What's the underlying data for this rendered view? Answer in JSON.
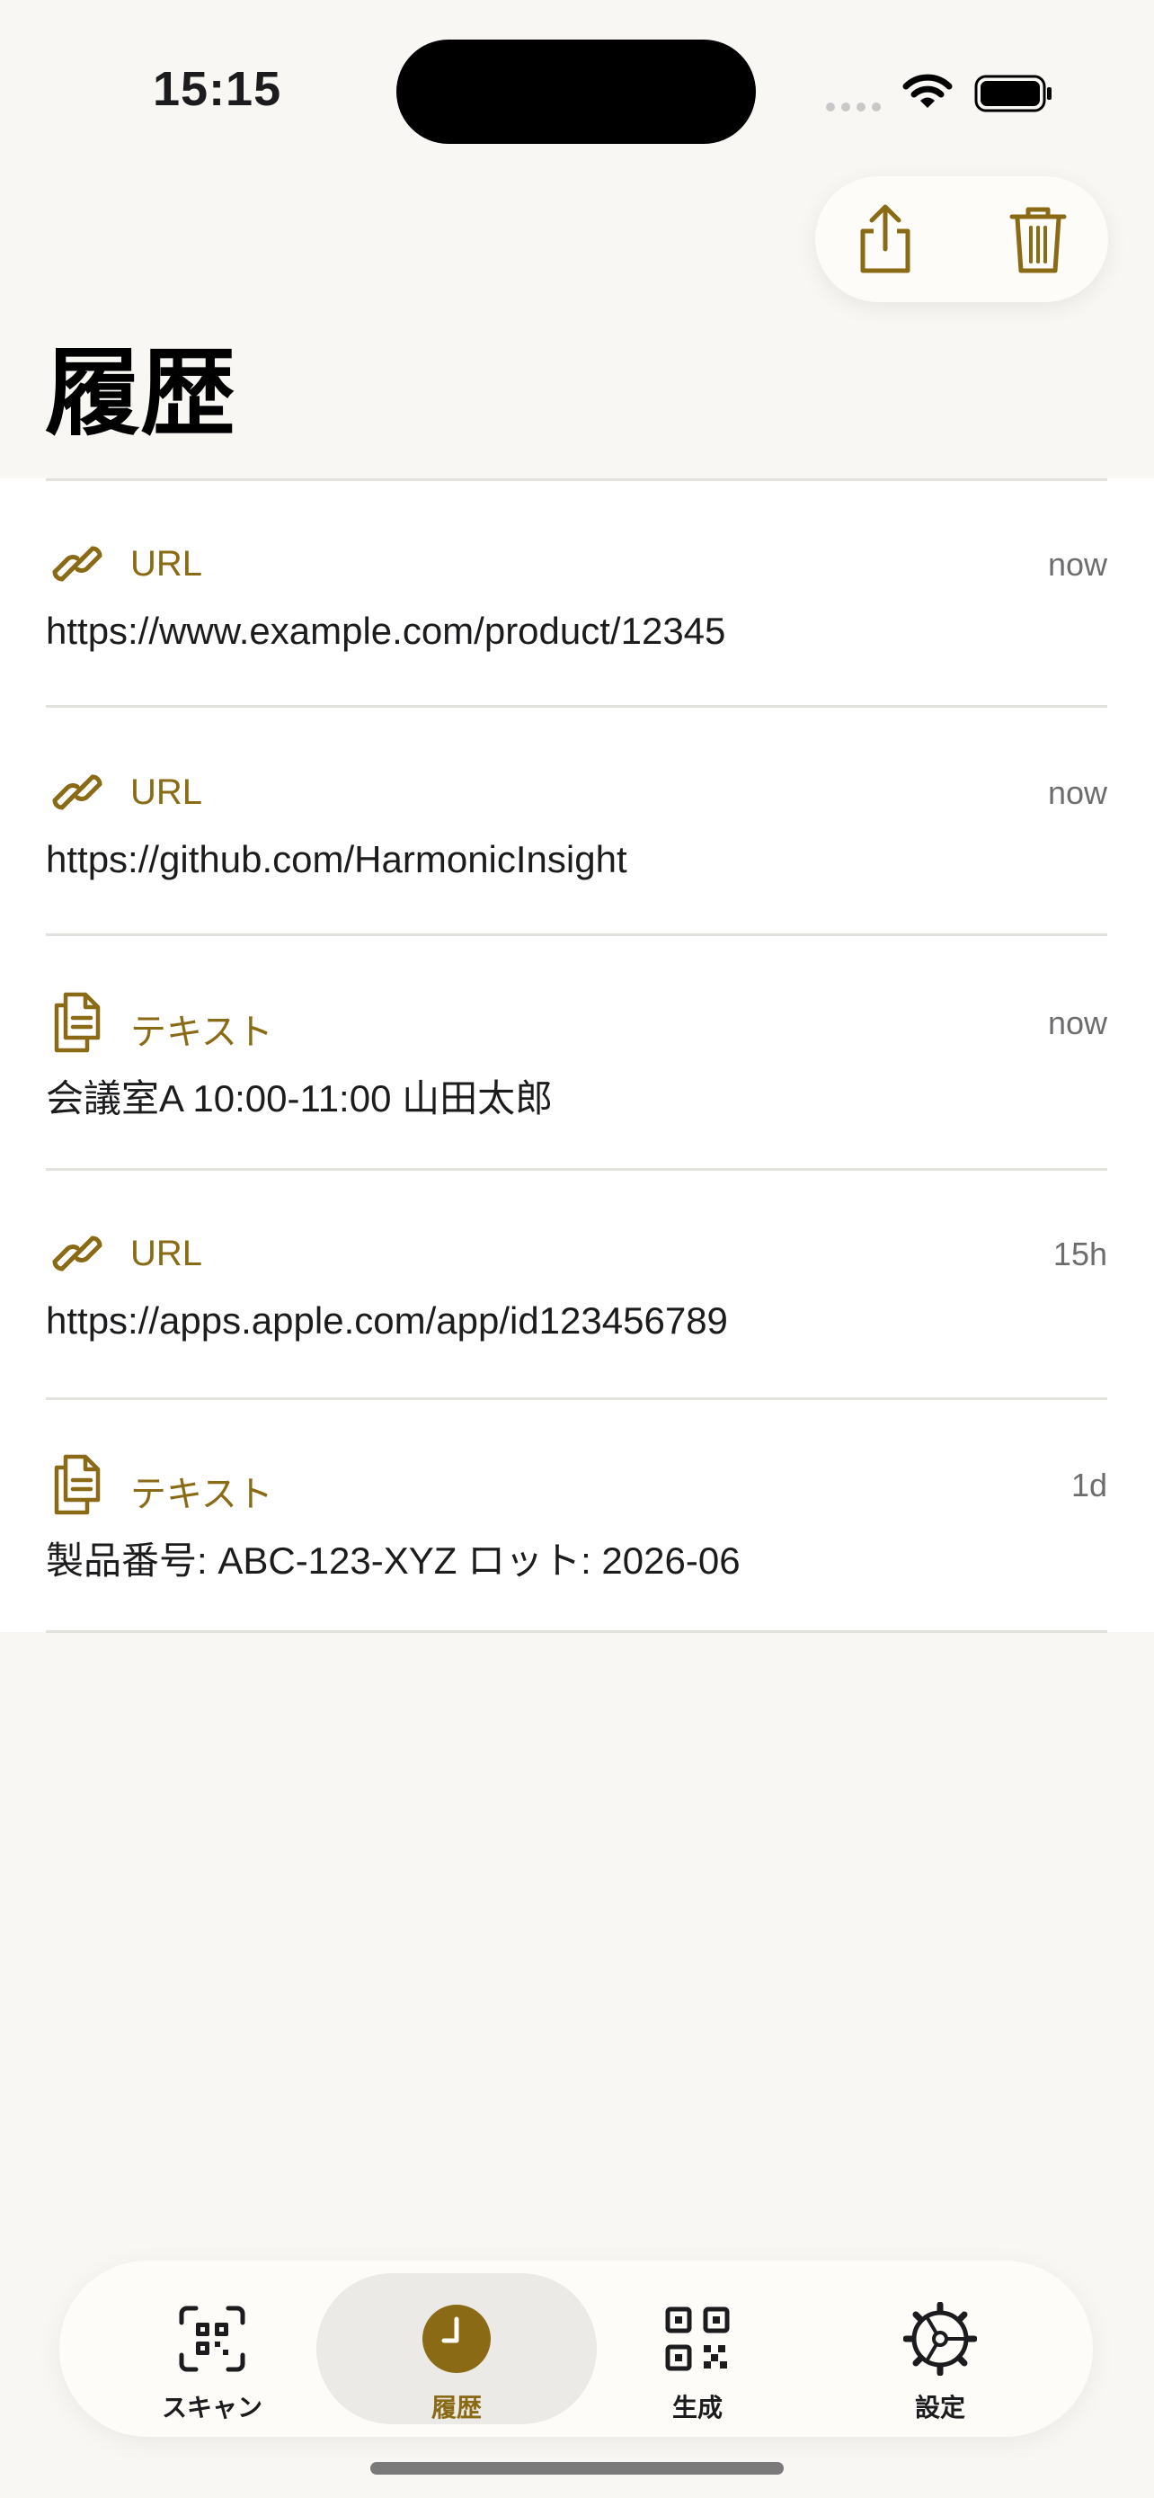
{
  "status": {
    "time": "15:15"
  },
  "toolbar": {
    "share_icon": "share-icon",
    "trash_icon": "trash-icon"
  },
  "page": {
    "title": "履歴"
  },
  "colors": {
    "accent": "#8a6a14",
    "background": "#f8f7f4"
  },
  "history": [
    {
      "icon": "link-icon",
      "type": "URL",
      "age": "now",
      "content": "https://www.example.com/product/12345"
    },
    {
      "icon": "link-icon",
      "type": "URL",
      "age": "now",
      "content": "https://github.com/HarmonicInsight"
    },
    {
      "icon": "document-icon",
      "type": "テキスト",
      "age": "now",
      "content": "会議室A 10:00-11:00 山田太郎"
    },
    {
      "icon": "link-icon",
      "type": "URL",
      "age": "15h",
      "content": "https://apps.apple.com/app/id123456789"
    },
    {
      "icon": "document-icon",
      "type": "テキスト",
      "age": "1d",
      "content": "製品番号: ABC-123-XYZ ロット: 2026-06"
    }
  ],
  "tabs": [
    {
      "label": "スキャン",
      "icon": "qr-scan-icon",
      "active": false
    },
    {
      "label": "履歴",
      "icon": "clock-icon",
      "active": true
    },
    {
      "label": "生成",
      "icon": "qr-code-icon",
      "active": false
    },
    {
      "label": "設定",
      "icon": "gear-icon",
      "active": false
    }
  ]
}
